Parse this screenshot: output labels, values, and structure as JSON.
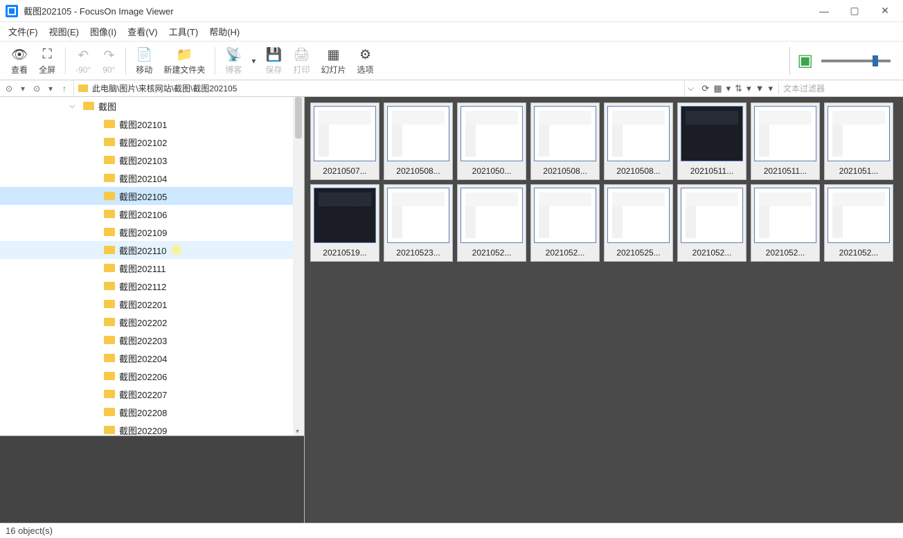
{
  "window": {
    "title": "截图202105 - FocusOn Image Viewer"
  },
  "menu": {
    "file": "文件(F)",
    "view": "视图(E)",
    "image": "图像(I)",
    "look": "查看(V)",
    "tool": "工具(T)",
    "help": "帮助(H)"
  },
  "toolbar": {
    "view": "查看",
    "fullscreen": "全屏",
    "rot_left": "-90°",
    "rot_right": "90°",
    "move": "移动",
    "newfolder": "新建文件夹",
    "blog": "博客",
    "save": "保存",
    "print": "打印",
    "slideshow": "幻灯片",
    "options": "选项"
  },
  "path": {
    "text": "此电脑\\图片\\来核网站\\截图\\截图202105"
  },
  "filter": {
    "placeholder": "文本过滤器"
  },
  "tree": {
    "parent": "截图",
    "items": [
      {
        "label": "截图202101"
      },
      {
        "label": "截图202102"
      },
      {
        "label": "截图202103"
      },
      {
        "label": "截图202104"
      },
      {
        "label": "截图202105",
        "selected": true
      },
      {
        "label": "截图202106"
      },
      {
        "label": "截图202109"
      },
      {
        "label": "截图202110",
        "hover": true
      },
      {
        "label": "截图202111"
      },
      {
        "label": "截图202112"
      },
      {
        "label": "截图202201"
      },
      {
        "label": "截图202202"
      },
      {
        "label": "截图202203"
      },
      {
        "label": "截图202204"
      },
      {
        "label": "截图202206"
      },
      {
        "label": "截图202207"
      },
      {
        "label": "截图202208"
      },
      {
        "label": "截图202209"
      }
    ]
  },
  "thumbs": [
    {
      "label": "20210507..."
    },
    {
      "label": "20210508..."
    },
    {
      "label": "2021050..."
    },
    {
      "label": "20210508..."
    },
    {
      "label": "20210508..."
    },
    {
      "label": "20210511...",
      "dark": true
    },
    {
      "label": "20210511..."
    },
    {
      "label": "2021051..."
    },
    {
      "label": "20210519...",
      "dark": true
    },
    {
      "label": "20210523..."
    },
    {
      "label": "2021052..."
    },
    {
      "label": "2021052..."
    },
    {
      "label": "20210525..."
    },
    {
      "label": "2021052..."
    },
    {
      "label": "2021052..."
    },
    {
      "label": "2021052..."
    }
  ],
  "status": {
    "text": "16 object(s)"
  }
}
